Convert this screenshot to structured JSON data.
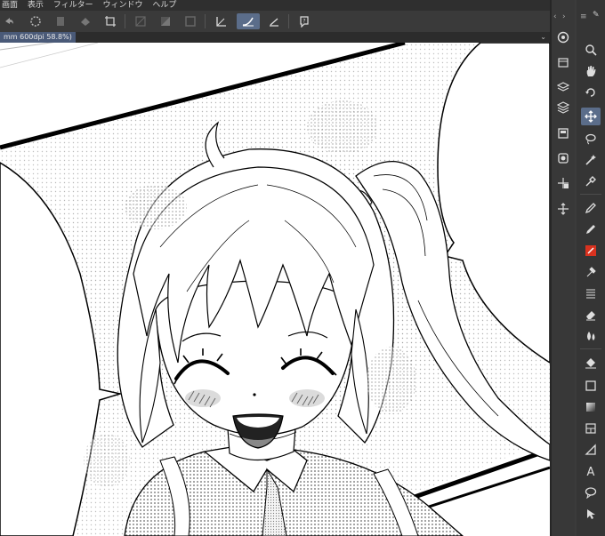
{
  "menu": [
    "画面",
    "表示",
    "フィルター",
    "ウィンドウ",
    "ヘルプ"
  ],
  "tab": {
    "label": "mm 600dpi 58.8%)"
  },
  "toolbar_icons": [
    "undo-icon",
    "spinner-icon",
    "clear-icon",
    "fill-icon",
    "crop-icon",
    "deselect-icon",
    "invert-icon",
    "border-icon",
    "ruler-icon",
    "stroke-icon",
    "vector-icon",
    "help-icon"
  ],
  "left_column_icons": [
    "navigator-icon",
    "layer-property-icon",
    "layers-icon",
    "layer-stack-icon",
    "sub-tool-icon",
    "material-icon",
    "transform-icon",
    "move-layer-icon"
  ],
  "tool_column_icons": [
    "zoom-icon",
    "hand-icon",
    "rotate-icon",
    "move-icon",
    "lasso-icon",
    "magic-wand-icon",
    "eyedropper-icon",
    "pen-icon",
    "pencil-icon",
    "brush-red-icon",
    "airbrush-icon",
    "decoration-icon",
    "eraser-icon",
    "blend-icon",
    "fill-bucket-icon",
    "figure-icon",
    "gradient-icon",
    "frame-icon",
    "ruler-tool-icon",
    "text-icon",
    "balloon-icon",
    "correct-line-icon"
  ],
  "colors": {
    "accent": "#5b6d8a",
    "panel": "#383838",
    "menubar": "#2f2f2f",
    "red_tool": "#d9321f"
  }
}
